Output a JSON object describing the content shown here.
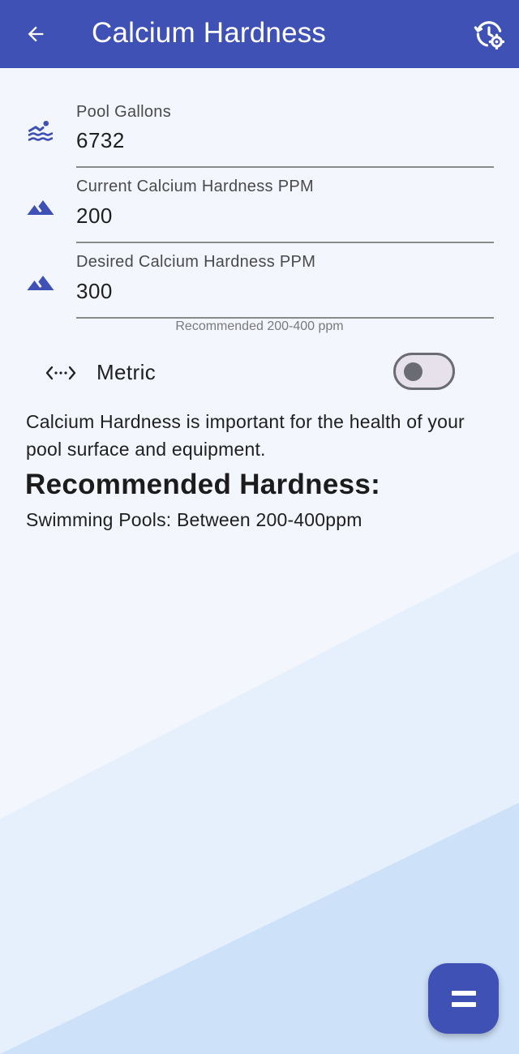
{
  "appbar": {
    "title": "Calcium Hardness",
    "back_icon": "arrow-back-icon",
    "settings_icon": "history-settings-icon"
  },
  "fields": [
    {
      "label": "Pool Gallons",
      "value": "6732",
      "icon": "pool-icon"
    },
    {
      "label": "Current Calcium Hardness PPM",
      "value": "200",
      "icon": "terrain-icon"
    },
    {
      "label": "Desired Calcium Hardness PPM",
      "value": "300",
      "icon": "terrain-icon"
    }
  ],
  "helper_text": "Recommended 200-400 ppm",
  "metric": {
    "label": "Metric",
    "icon": "code-dots-icon",
    "enabled": false
  },
  "description": "Calcium Hardness is important for the health of your pool surface and equipment.",
  "heading": "Recommended Hardness:",
  "recommendation": "Swimming Pools: Between 200-400ppm",
  "fab_icon": "equals-icon",
  "colors": {
    "primary": "#3f51b5",
    "background": "#f3f6fc",
    "accent_light": "#cfe2f8"
  }
}
